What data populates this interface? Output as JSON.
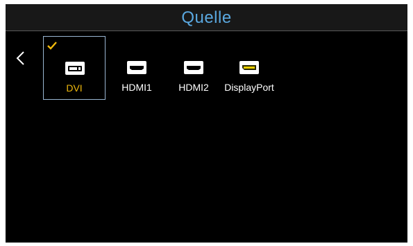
{
  "header": {
    "title": "Quelle"
  },
  "colors": {
    "background": "#000000",
    "title": "#5aa8e0",
    "selected_label": "#f0b90c",
    "selected_border": "#9ab7d3",
    "check": "#f0b90c"
  },
  "nav": {
    "back_icon": "chevron-left-icon"
  },
  "sources": [
    {
      "label": "DVI",
      "icon": "dvi-port-icon",
      "selected": true
    },
    {
      "label": "HDMI1",
      "icon": "hdmi-port-icon",
      "selected": false
    },
    {
      "label": "HDMI2",
      "icon": "hdmi-port-icon",
      "selected": false
    },
    {
      "label": "DisplayPort",
      "icon": "displayport-port-icon",
      "selected": false
    }
  ]
}
